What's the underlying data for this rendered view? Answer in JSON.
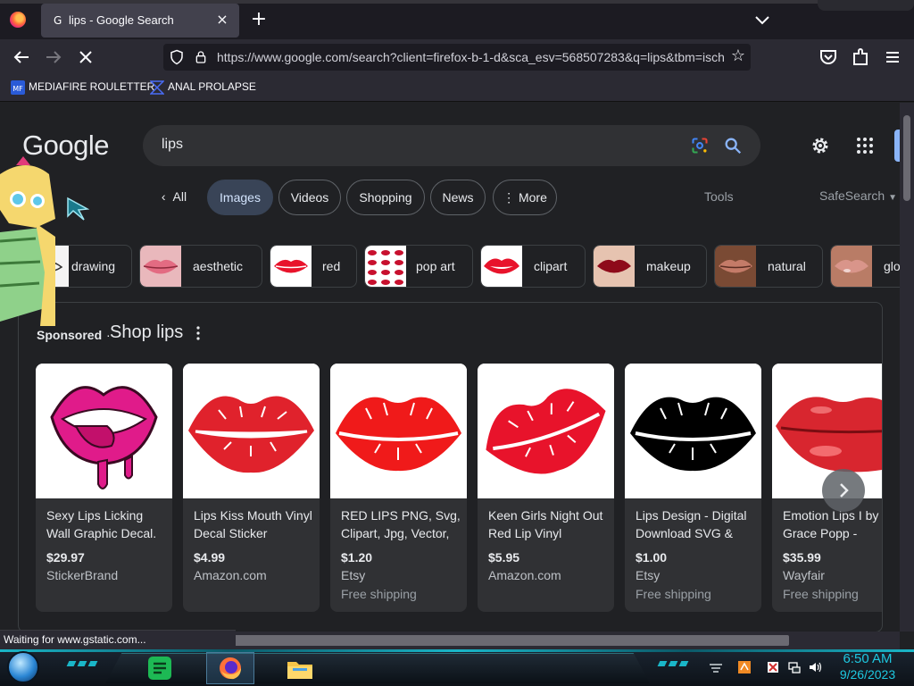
{
  "browser": {
    "tab_title": "lips - Google Search",
    "tab_favicon": "G",
    "tab_close": "×",
    "new_tab": "+",
    "url": "https://www.google.com/search?client=firefox-b-1-d&sca_esv=568507283&q=lips&tbm=isch",
    "bookmarks": [
      {
        "label": "MEDIAFIRE ROULETTER",
        "icon": "mediafire-icon"
      },
      {
        "label": "ANAL PROLAPSE",
        "icon": "bookmark-x-icon"
      }
    ],
    "status_text": "Waiting for www.gstatic.com..."
  },
  "google": {
    "logo": "Google",
    "query": "lips",
    "filters": [
      "All",
      "Images",
      "Videos",
      "Shopping",
      "News",
      "More"
    ],
    "active_filter": "Images",
    "tools": "Tools",
    "safesearch": "SafeSearch",
    "refinements": [
      "drawing",
      "aesthetic",
      "red",
      "pop art",
      "clipart",
      "makeup",
      "natural",
      "glo"
    ],
    "sponsored_label": "Sponsored",
    "sponsored_dot": "·",
    "shop_title": "Shop lips",
    "products": [
      {
        "title": "Sexy Lips Licking Wall Graphic Decal.",
        "price": "$29.97",
        "store": "StickerBrand",
        "shipping": ""
      },
      {
        "title": "Lips Kiss Mouth Vinyl Decal Sticker",
        "price": "$4.99",
        "store": "Amazon.com",
        "shipping": ""
      },
      {
        "title": "RED LIPS PNG, Svg, Clipart, Jpg, Vector,",
        "price": "$1.20",
        "store": "Etsy",
        "shipping": "Free shipping"
      },
      {
        "title": "Keen Girls Night Out Red Lip Vinyl",
        "price": "$5.95",
        "store": "Amazon.com",
        "shipping": ""
      },
      {
        "title": "Lips Design - Digital Download SVG &",
        "price": "$1.00",
        "store": "Etsy",
        "shipping": "Free shipping"
      },
      {
        "title": "Emotion Lips I by Grace Popp -",
        "price": "$35.99",
        "store": "Wayfair",
        "shipping": "Free shipping"
      }
    ]
  },
  "taskbar": {
    "time": "6:50 AM",
    "date": "9/26/2023"
  },
  "colors": {
    "page_bg": "#202124",
    "chip_active": "#394457",
    "lip_red": "#e8132b",
    "clock_cyan": "#1ec8e0"
  }
}
